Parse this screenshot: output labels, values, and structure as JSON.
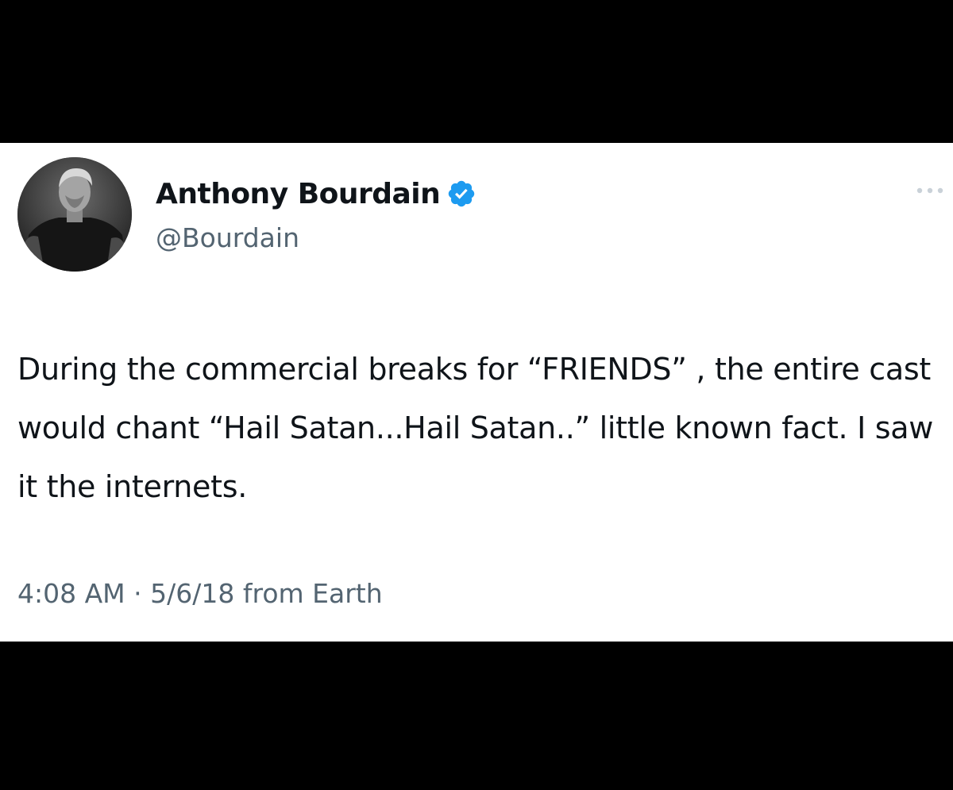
{
  "tweet": {
    "author": {
      "display_name": "Anthony Bourdain",
      "handle": "@Bourdain",
      "verified": true,
      "avatar_icon": "profile-photo"
    },
    "text": "During the commercial breaks for “FRIENDS” , the entire cast would chant “Hail Satan...Hail Satan..” little known fact. I saw it the internets.",
    "time": "4:08 AM",
    "separator": "·",
    "date": "5/6/18",
    "source": "from Earth",
    "more_icon": "ellipsis-icon"
  },
  "colors": {
    "background": "#000000",
    "card": "#ffffff",
    "text_primary": "#0f1419",
    "text_secondary": "#536471",
    "verified_badge": "#1d9bf0"
  }
}
